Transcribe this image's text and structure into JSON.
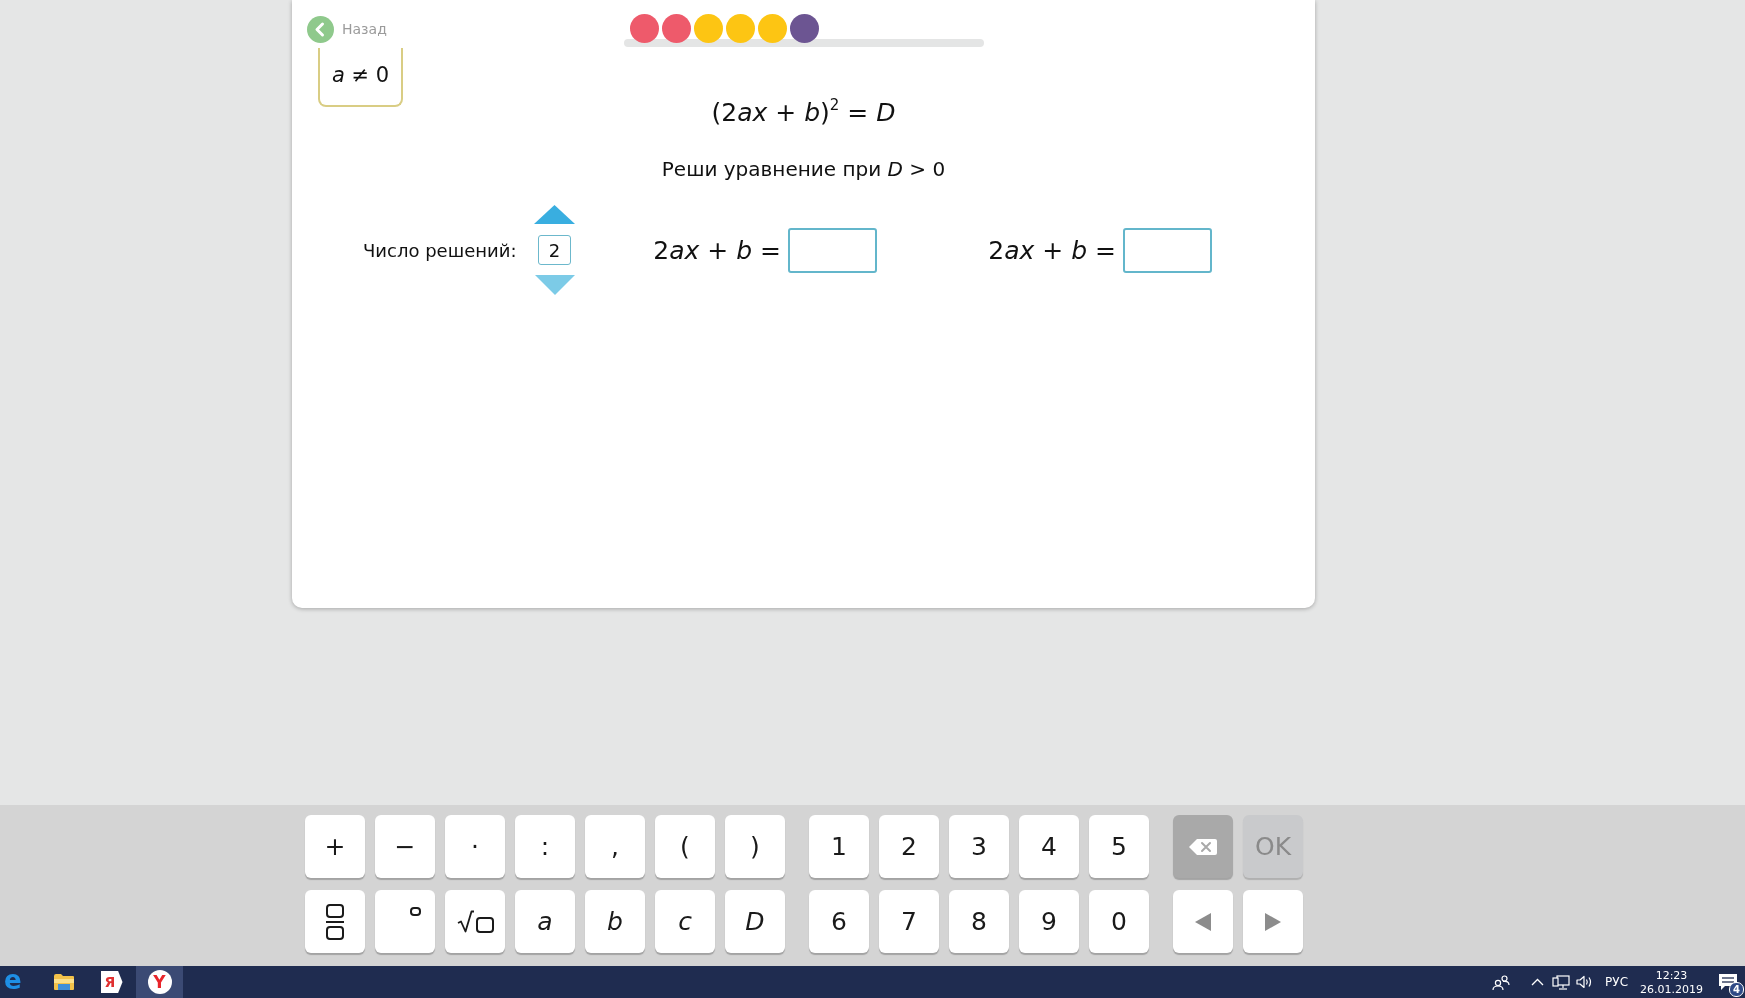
{
  "header": {
    "back_button": {
      "label": "Назад"
    },
    "condition": "*a* ≠ 0"
  },
  "progress": {
    "dots": [
      {
        "color": "#ee5a6b"
      },
      {
        "color": "#ee5a6b"
      },
      {
        "color": "#fdc513"
      },
      {
        "color": "#fdc513"
      },
      {
        "color": "#fdc513"
      },
      {
        "color": "#6c5592"
      }
    ]
  },
  "task": {
    "formula": [
      {
        "kind": "plain",
        "text": "(2"
      },
      {
        "kind": "italic",
        "text": "ax"
      },
      {
        "kind": "plain",
        "text": " + "
      },
      {
        "kind": "italic",
        "text": "b"
      },
      {
        "kind": "plain",
        "text": ")"
      },
      {
        "kind": "raised",
        "text": "2"
      },
      {
        "kind": "plain",
        "text": " = "
      },
      {
        "kind": "italic",
        "text": "D"
      }
    ],
    "instruction": "Реши уравнение при *D* > 0",
    "solution_count": {
      "label": "Число решений:",
      "value": "2"
    },
    "answers": [
      {
        "label": [
          {
            "kind": "plain",
            "text": "2"
          },
          {
            "kind": "italic",
            "text": "ax"
          },
          {
            "kind": "plain",
            "text": " + "
          },
          {
            "kind": "italic",
            "text": "b"
          },
          {
            "kind": "plain",
            "text": " ="
          }
        ]
      },
      {
        "label": [
          {
            "kind": "plain",
            "text": "2"
          },
          {
            "kind": "italic",
            "text": "ax"
          },
          {
            "kind": "plain",
            "text": " + "
          },
          {
            "kind": "italic",
            "text": "b"
          },
          {
            "kind": "plain",
            "text": " ="
          }
        ]
      }
    ]
  },
  "keyboard": {
    "groups": [
      {
        "rows": [
          [
            {
              "kind": "char",
              "label": "+",
              "disabled": false
            },
            {
              "kind": "char",
              "label": "−",
              "disabled": false
            },
            {
              "kind": "char",
              "label": "·",
              "disabled": false
            },
            {
              "kind": "char",
              "label": ":",
              "disabled": false
            },
            {
              "kind": "char",
              "label": ",",
              "disabled": false
            },
            {
              "kind": "char",
              "label": "(",
              "disabled": false
            },
            {
              "kind": "char",
              "label": ")",
              "disabled": false
            }
          ],
          [
            {
              "kind": "fraction",
              "disabled": false
            },
            {
              "kind": "power",
              "disabled": false
            },
            {
              "kind": "sqrt",
              "disabled": false
            },
            {
              "kind": "variable",
              "label": "a",
              "disabled": false
            },
            {
              "kind": "variable",
              "label": "b",
              "disabled": false
            },
            {
              "kind": "variable",
              "label": "c",
              "disabled": false
            },
            {
              "kind": "variable",
              "label": "D",
              "disabled": false
            }
          ]
        ]
      },
      {
        "rows": [
          [
            {
              "kind": "char",
              "label": "1",
              "disabled": false
            },
            {
              "kind": "char",
              "label": "2",
              "disabled": false
            },
            {
              "kind": "char",
              "label": "3",
              "disabled": false
            },
            {
              "kind": "char",
              "label": "4",
              "disabled": false
            },
            {
              "kind": "char",
              "label": "5",
              "disabled": false
            }
          ],
          [
            {
              "kind": "char",
              "label": "6",
              "disabled": false
            },
            {
              "kind": "char",
              "label": "7",
              "disabled": false
            },
            {
              "kind": "char",
              "label": "8",
              "disabled": false
            },
            {
              "kind": "char",
              "label": "9",
              "disabled": false
            },
            {
              "kind": "char",
              "label": "0",
              "disabled": false
            }
          ]
        ]
      },
      {
        "rows": [
          [
            {
              "kind": "backspace",
              "disabled": false
            },
            {
              "kind": "char",
              "label": "OK",
              "disabled": true
            }
          ],
          [
            {
              "kind": "left",
              "disabled": false
            },
            {
              "kind": "right",
              "disabled": false
            }
          ]
        ]
      }
    ]
  },
  "taskbar": {
    "apps": [
      {
        "kind": "e-logo",
        "label": "e",
        "selected": false
      },
      {
        "kind": "folder",
        "selected": false
      },
      {
        "kind": "tile",
        "label": "Я",
        "selected": false
      },
      {
        "kind": "y-logo",
        "label": "Y",
        "selected": true
      }
    ],
    "tray": {
      "language": "РУС",
      "time": "12:23",
      "date": "26.01.2019",
      "notifications": "4"
    }
  }
}
